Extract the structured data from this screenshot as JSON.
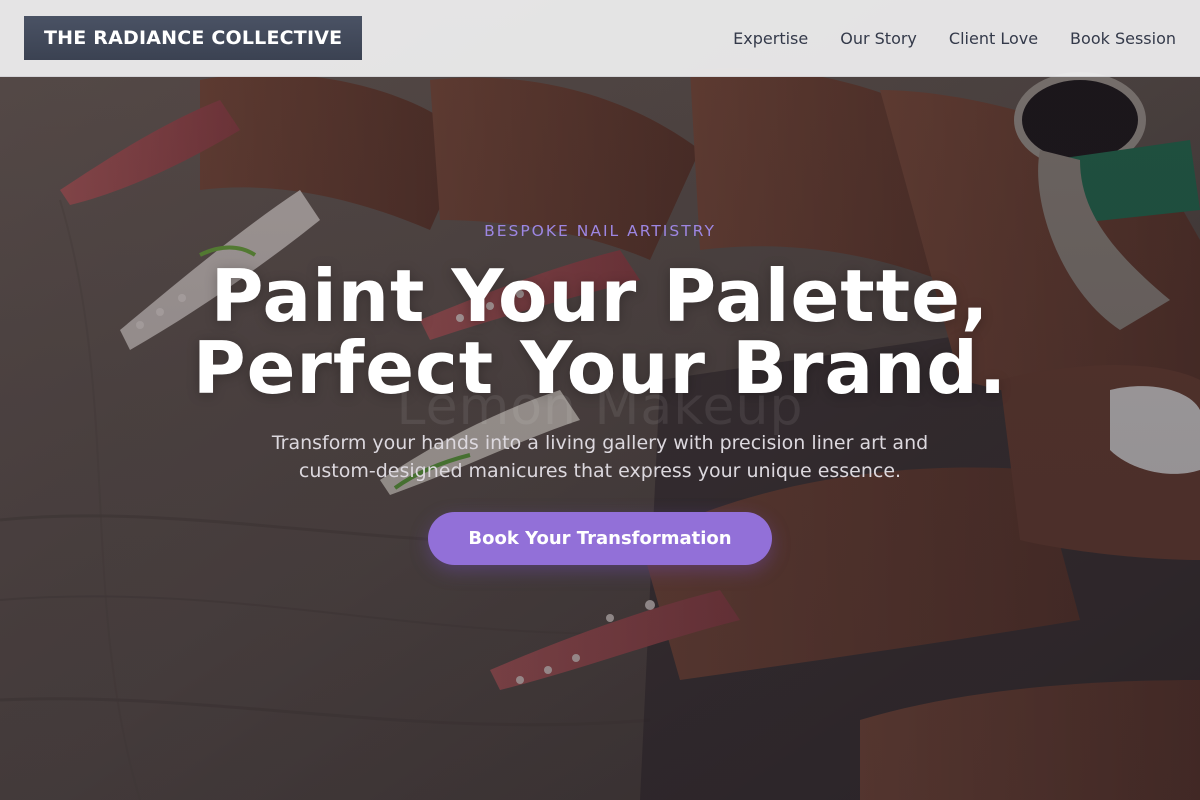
{
  "brand": {
    "name": "THE RADIANCE COLLECTIVE"
  },
  "nav": {
    "items": [
      {
        "label": "Expertise"
      },
      {
        "label": "Our Story"
      },
      {
        "label": "Client Love"
      },
      {
        "label": "Book Session"
      }
    ]
  },
  "hero": {
    "eyebrow": "BESPOKE NAIL ARTISTRY",
    "headline_line1": "Paint Your Palette,",
    "headline_line2": "Perfect Your Brand.",
    "ghost_text": "Lemon Makeup",
    "subheadline": "Transform your hands into a living gallery with precision liner art and custom-designed manicures that express your unique essence.",
    "cta_label": "Book Your Transformation",
    "background_image": "hands-with-decorated-nail-art-photo"
  },
  "colors": {
    "header_bg": "#f0f0f1",
    "logo_bg": "#3b4252",
    "nav_text": "#343a4a",
    "accent": "#9270d8",
    "eyebrow": "#9d86e2"
  }
}
